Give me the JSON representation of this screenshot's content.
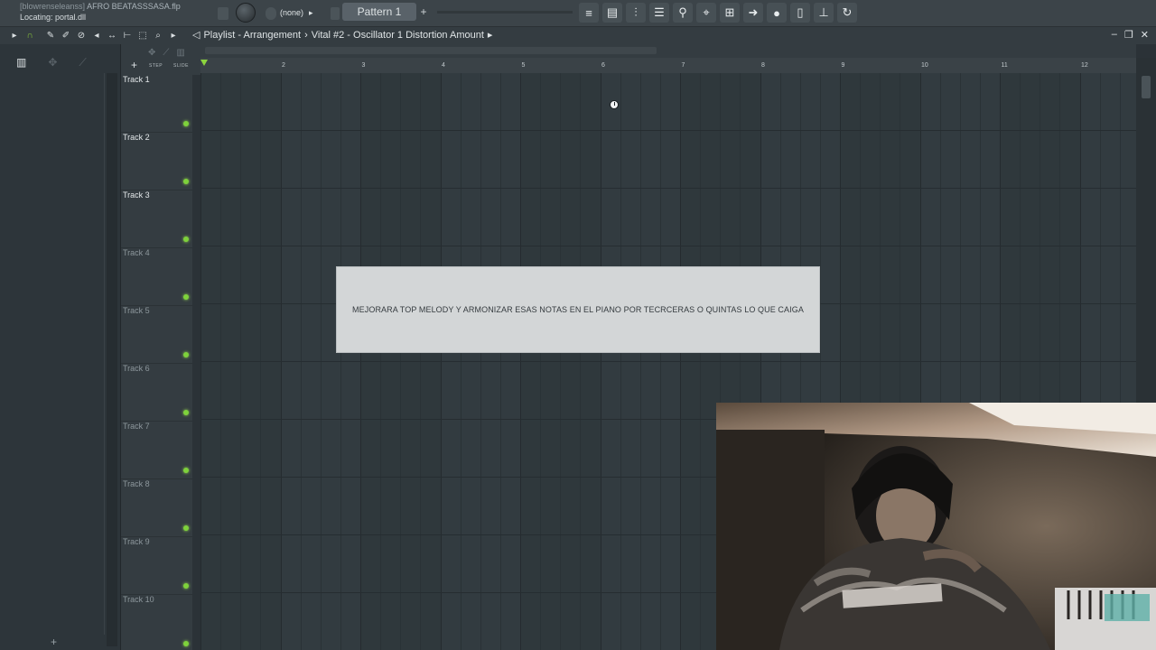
{
  "window": {
    "file_prefix": "[blowrenseleanss]",
    "file_name": "AFRO BEATASSSASA.flp",
    "hint_text": "Locating: portal.dll"
  },
  "toolbar": {
    "pattern_selector": "(none)",
    "pattern_name": "Pattern 1",
    "add_pattern": "+",
    "icons": [
      "playlist-icon",
      "piano-roll-icon",
      "mixer-icon",
      "channel-rack-icon",
      "plugin-picker-icon",
      "browser-icon",
      "project-tree-icon",
      "export-icon",
      "recorder-icon",
      "file-icon",
      "stamp-icon",
      "refresh-icon"
    ]
  },
  "playlist": {
    "title": "Playlist - Arrangement",
    "separator": "›",
    "target": "Vital #2 - Oscillator 1 Distortion Amount",
    "step_label": "STEP",
    "slide_label": "SLIDE",
    "add_track": "+",
    "ruler": [
      "2",
      "3",
      "4",
      "5",
      "6",
      "7",
      "8",
      "9",
      "10",
      "11",
      "12"
    ]
  },
  "tracks": [
    {
      "label": "Track 1",
      "active": true
    },
    {
      "label": "Track 2",
      "active": true
    },
    {
      "label": "Track 3",
      "active": true
    },
    {
      "label": "Track 4",
      "active": false
    },
    {
      "label": "Track 5",
      "active": false
    },
    {
      "label": "Track 6",
      "active": false
    },
    {
      "label": "Track 7",
      "active": false
    },
    {
      "label": "Track 8",
      "active": false
    },
    {
      "label": "Track 9",
      "active": false
    },
    {
      "label": "Track 10",
      "active": false
    }
  ],
  "note": {
    "text": "MEJORARA TOP MELODY Y ARMONIZAR ESAS NOTAS EN EL PIANO POR TECRCERAS O QUINTAS LO QUE CAIGA"
  },
  "browser": {
    "add_label": "+"
  },
  "colors": {
    "accent_green": "#7ed23b",
    "background": "#2f383c",
    "note_background": "#d3d6d7"
  }
}
